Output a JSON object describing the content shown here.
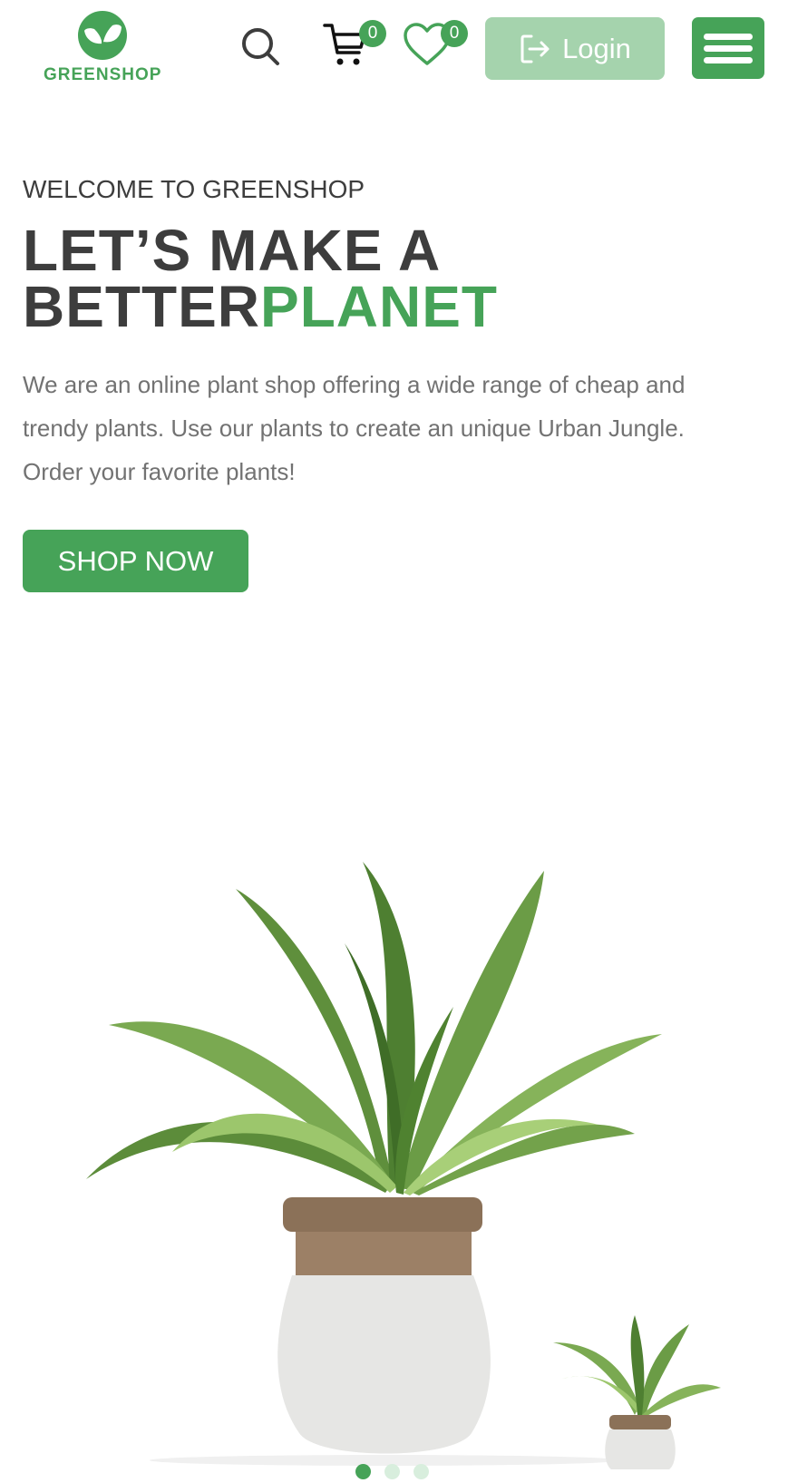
{
  "brand": {
    "name": "GREENSHOP"
  },
  "header": {
    "search_icon": "search-icon",
    "cart": {
      "icon": "cart-icon",
      "count": "0"
    },
    "wishlist": {
      "icon": "heart-icon",
      "count": "0"
    },
    "login": {
      "icon": "logout-arrow-icon",
      "label": "Login"
    },
    "menu_icon": "hamburger-icon"
  },
  "hero": {
    "welcome": "WELCOME TO GREENSHOP",
    "headline_line1": "LET’S MAKE A",
    "headline_dark": "BETTER",
    "headline_accent": "PLANET",
    "description": "We are an online plant shop offering a wide range of cheap and trendy plants. Use our plants to create an unique Urban Jungle. Order your favorite plants!",
    "cta_label": "SHOP NOW"
  },
  "carousel": {
    "slide_count": 3,
    "active_index": 0
  },
  "colors": {
    "accent": "#46a358",
    "accent_light": "#a5d3ad",
    "text_dark": "#3d3d3d",
    "text_muted": "#727272",
    "dot_inactive": "#d8eedd"
  }
}
